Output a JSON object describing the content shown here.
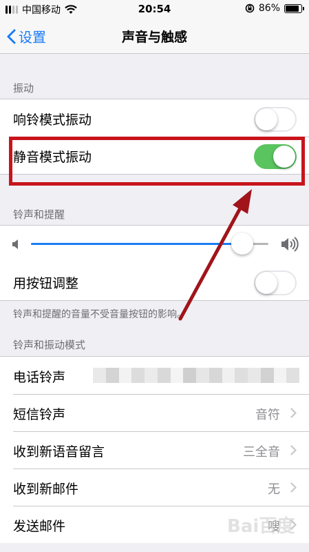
{
  "status_bar": {
    "carrier": "中国移动",
    "time": "20:54",
    "battery": "86%",
    "battery_level": 0.86
  },
  "nav": {
    "back_label": "设置",
    "title": "声音与触感"
  },
  "vibration": {
    "header": "振动",
    "rows": [
      {
        "label": "响铃模式振动",
        "on": false
      },
      {
        "label": "静音模式振动",
        "on": true
      }
    ]
  },
  "ringer": {
    "header": "铃声和提醒",
    "volume_level": 0.89,
    "change_with_buttons_label": "用按钮调整",
    "change_with_buttons_on": false,
    "footer": "铃声和提醒的音量不受音量按钮的影响。"
  },
  "patterns": {
    "header": "铃声和振动模式",
    "rows": [
      {
        "label": "电话铃声",
        "value": ""
      },
      {
        "label": "短信铃声",
        "value": "音符"
      },
      {
        "label": "收到新语音留言",
        "value": "三全音"
      },
      {
        "label": "收到新邮件",
        "value": "无"
      },
      {
        "label": "发送邮件",
        "value": "嗖"
      }
    ]
  },
  "colors": {
    "accent": "#1a7cf5",
    "toggle_on": "#5ac45f",
    "annotation": "#c8141b"
  }
}
